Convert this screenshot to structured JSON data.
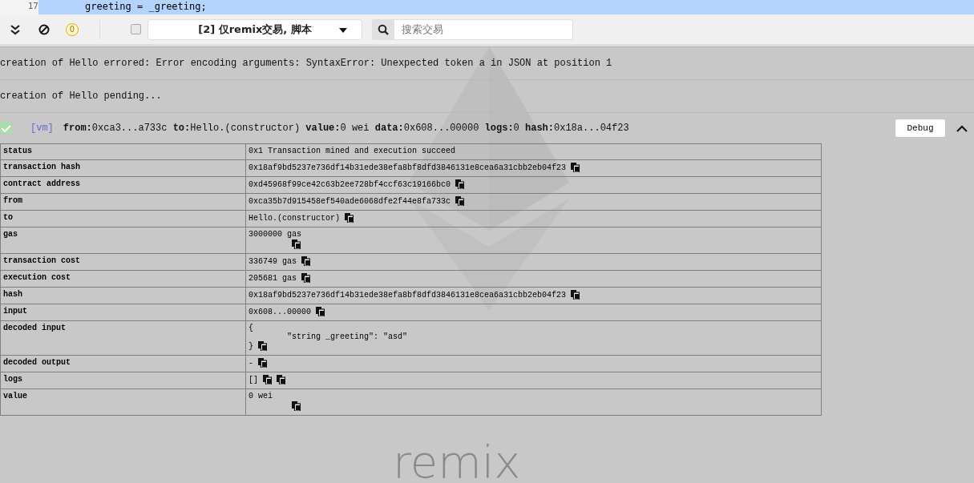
{
  "editor": {
    "line_number": "17",
    "code": "greeting = _greeting;"
  },
  "toolbar": {
    "pending_count": "0",
    "listen_checkbox": {
      "checked": false
    },
    "filter": "[2] 仅remix交易, 脚本",
    "search": {
      "placeholder": "搜索交易"
    }
  },
  "background_logo": {
    "text": "remix"
  },
  "terminal": {
    "messages": [
      {
        "kind": "log",
        "text": "creation of Hello errored: Error encoding arguments: SyntaxError: Unexpected token a in JSON at position 1"
      },
      {
        "kind": "log",
        "text": "creation of Hello pending..."
      },
      {
        "kind": "transaction",
        "succeeded": true,
        "env": "[vm]",
        "summary": "**from:**0xca3...a733c **to:**Hello.(constructor) **value:**0 wei **data:**0x608...00000 **logs:**0 **hash:**0x18a...04f23",
        "debug_label": "Debug",
        "expanded": true,
        "details": [
          {
            "key": "status",
            "value": "0x1 Transaction mined and execution succeed"
          },
          {
            "key": "transaction hash",
            "value": "0x18af9bd5237e736df14b31ede38efa8bf8dfd3846131e8cea6a31cbb2eb04f23",
            "copy": true
          },
          {
            "key": "contract address",
            "value": "0xd45968f99ce42c63b2ee728bf4ccf63c19166bc0",
            "copy": true
          },
          {
            "key": "from",
            "value": "0xca35b7d915458ef540ade6068dfe2f44e8fa733c",
            "copy": true
          },
          {
            "key": "to",
            "value": "Hello.(constructor)",
            "copy": true
          },
          {
            "key": "gas",
            "value": "3000000 gas",
            "copy": true,
            "copy_below": true
          },
          {
            "key": "transaction cost",
            "value": "336749 gas",
            "copy": true
          },
          {
            "key": "execution cost",
            "value": "205681 gas",
            "copy": true
          },
          {
            "key": "hash",
            "value": "0x18af9bd5237e736df14b31ede38efa8bf8dfd3846131e8cea6a31cbb2eb04f23",
            "copy": true
          },
          {
            "key": "input",
            "value": "0x608...00000",
            "copy": true
          },
          {
            "key": "decoded input",
            "value": "{\n\t\"string _greeting\": \"asd\"\n}",
            "copy": true
          },
          {
            "key": "decoded output",
            "value": "-",
            "copy": true
          },
          {
            "key": "logs",
            "value": "[]",
            "copy": true,
            "copy_twice": true
          },
          {
            "key": "value",
            "value": "0 wei",
            "copy": true,
            "copy_below": true
          }
        ]
      }
    ]
  }
}
